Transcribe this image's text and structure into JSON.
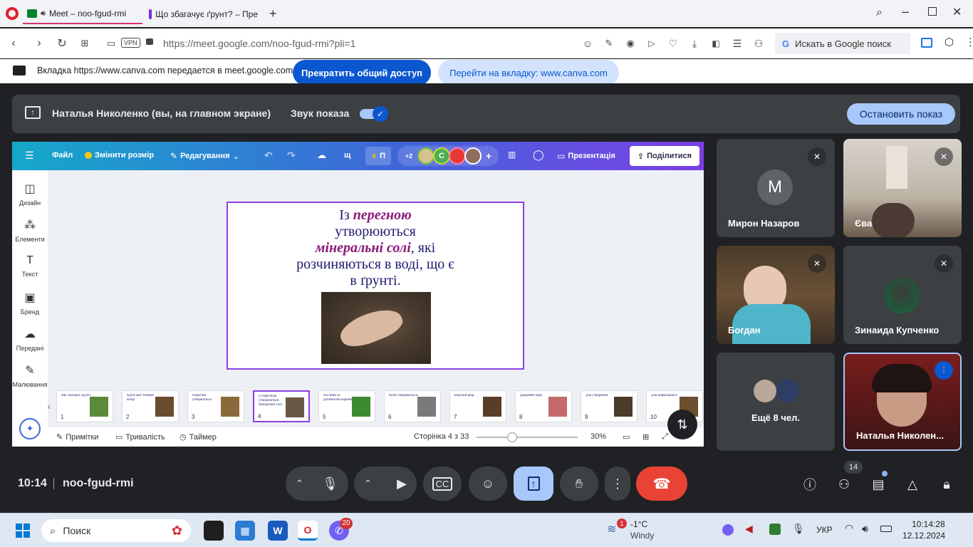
{
  "browser": {
    "tabs": [
      {
        "title": "Meet – noo-fgud-rmi",
        "active": true
      },
      {
        "title": "Що збагачує ґрунт? – Пре",
        "active": false
      }
    ],
    "url": "https://meet.google.com/noo-fgud-rmi?pli=1",
    "vpn_label": "VPN",
    "search_placeholder": "Искать в Google поиск"
  },
  "share_notice": {
    "text": "Вкладка https://www.canva.com передается в meet.google.com",
    "stop_label": "Прекратить общий доступ",
    "goto_label": "Перейти на вкладку: www.canva.com"
  },
  "presenting_bar": {
    "name": "Наталья Николенко (вы, на главном экране)",
    "sound_label": "Звук показа",
    "sound_on": true,
    "stop_label": "Остановить показ"
  },
  "canva": {
    "toolbar": {
      "file": "Файл",
      "resize": "Змінити розмір",
      "edit": "Редагування",
      "text_short": "щ",
      "pro_short": "П",
      "collab_count": "+2",
      "collab_initial": "C",
      "present": "Презентація",
      "share": "Поділитися"
    },
    "sidebar": [
      "Дизайн",
      "Елементи",
      "Текст",
      "Бренд",
      "Передані",
      "Малювання"
    ],
    "slide": {
      "line1_prefix": "Із ",
      "line1_highlight": "перегною",
      "line2": "утворюються",
      "line3_highlight": "мінеральні солі",
      "line3_suffix": ", які",
      "line4": "розчиняються в воді, що є",
      "line5": "в ґрунті."
    },
    "thumbnails": [
      {
        "num": "1",
        "text": "Що збагачує ґрунт?"
      },
      {
        "num": "2",
        "text": "Ґрунт має темний колір"
      },
      {
        "num": "3",
        "text": "Перегній утворюється"
      },
      {
        "num": "4",
        "text": "Із перегною утворюються мінеральні солі",
        "selected": true
      },
      {
        "num": "5",
        "text": "Рослини за допомогою коренів"
      },
      {
        "num": "6",
        "text": "Коли створюються"
      },
      {
        "num": "7",
        "text": "Верхній шар"
      },
      {
        "num": "8",
        "text": "Дощовий черв"
      },
      {
        "num": "9",
        "text": "Для утворення"
      },
      {
        "num": "10",
        "text": "Для нормального"
      }
    ],
    "bottom": {
      "notes": "Примітки",
      "duration": "Тривалість",
      "timer": "Таймер",
      "page": "Сторінка 4 з 33",
      "zoom": "30%",
      "zoom_fraction": 0.3
    }
  },
  "participants": [
    {
      "name": "Мирон Назаров",
      "initial": "M",
      "muted": true
    },
    {
      "name": "Єва",
      "muted": true
    },
    {
      "name": "Богдан",
      "muted": true
    },
    {
      "name": "Зинаида Купченко",
      "muted": true
    },
    {
      "name": "Ещё 8 чел."
    },
    {
      "name": "Наталья Николен...",
      "speaking": true
    }
  ],
  "controls": {
    "time": "10:14",
    "meeting_code": "noo-fgud-rmi",
    "participants_badge": "14"
  },
  "taskbar": {
    "search_label": "Поиск",
    "viber_badge": "20",
    "weather_badge": "1",
    "weather_temp": "-1°C",
    "weather_desc": "Windy",
    "lang": "УКР",
    "clock_time": "10:14:28",
    "clock_date": "12.12.2024"
  },
  "colors": {
    "accent_blue": "#0b57d0",
    "meet_bg": "#202124",
    "end_call_red": "#ea4335",
    "canva_purple": "#8b3fe4"
  }
}
